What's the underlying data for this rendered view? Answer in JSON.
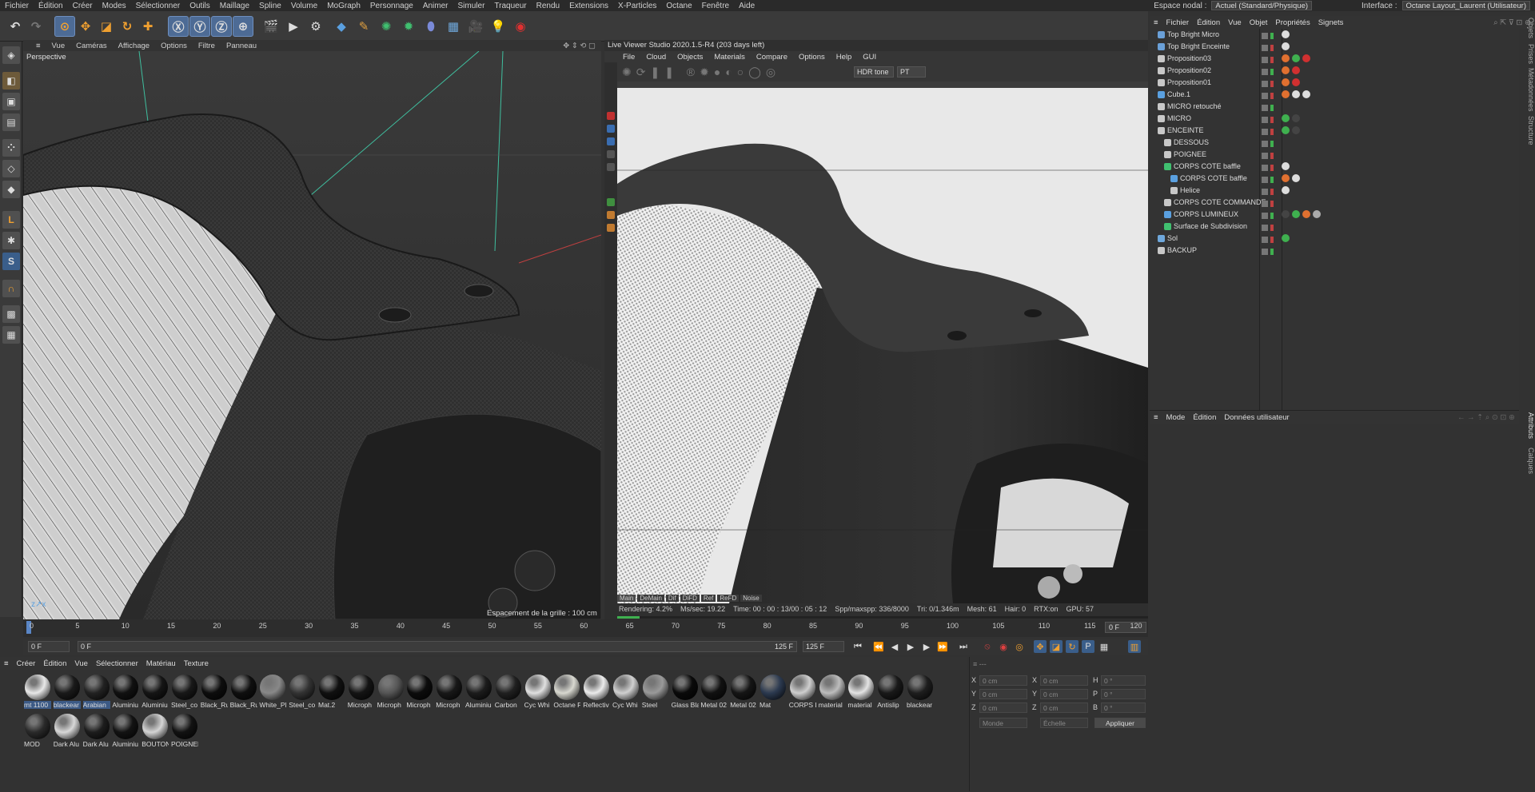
{
  "menubar": {
    "items": [
      "Fichier",
      "Édition",
      "Créer",
      "Modes",
      "Sélectionner",
      "Outils",
      "Maillage",
      "Spline",
      "Volume",
      "MoGraph",
      "Personnage",
      "Animer",
      "Simuler",
      "Traqueur",
      "Rendu",
      "Extensions",
      "X-Particles",
      "Octane",
      "Fenêtre",
      "Aide"
    ],
    "nodal_label": "Espace nodal :",
    "nodal_value": "Actuel (Standard/Physique)",
    "interface_label": "Interface :",
    "interface_value": "Octane Layout_Laurent (Utilisateur)"
  },
  "viewport": {
    "menu": [
      "Vue",
      "Caméras",
      "Affichage",
      "Options",
      "Filtre",
      "Panneau"
    ],
    "label": "Perspective",
    "grid_text": "Espacement de la grille : 100 cm"
  },
  "live_viewer": {
    "title": "Live Viewer Studio 2020.1.5-R4 (203 days left)",
    "menu": [
      "File",
      "Cloud",
      "Objects",
      "Materials",
      "Compare",
      "Options",
      "Help",
      "GUI"
    ],
    "tone": "HDR tone",
    "mode": "PT",
    "tabs": [
      "Main",
      "DeMain",
      "Dif",
      "DiFD",
      "Ref",
      "ReFD",
      "Noise"
    ],
    "status": {
      "rendering": "Rendering: 4.2%",
      "ms": "Ms/sec: 19.22",
      "time": "Time: 00 : 00 : 13/00 : 05 : 12",
      "spp": "Spp/maxspp: 336/8000",
      "tri": "Tri: 0/1.346m",
      "mesh": "Mesh: 61",
      "hair": "Hair: 0",
      "rtx": "RTX:on",
      "gpu": "GPU: 57"
    },
    "progress": 0.042
  },
  "object_manager": {
    "menu": [
      "Fichier",
      "Édition",
      "Vue",
      "Objet",
      "Propriétés",
      "Signets"
    ],
    "objects": [
      {
        "name": "Top Bright Micro",
        "depth": 0
      },
      {
        "name": "Top Bright Enceinte",
        "depth": 0
      },
      {
        "name": "Proposition03",
        "depth": 0
      },
      {
        "name": "Proposition02",
        "depth": 0
      },
      {
        "name": "Proposition01",
        "depth": 0
      },
      {
        "name": "Cube.1",
        "depth": 0
      },
      {
        "name": "MICRO retouché",
        "depth": 0
      },
      {
        "name": "MICRO",
        "depth": 0
      },
      {
        "name": "ENCEINTE",
        "depth": 0
      },
      {
        "name": "DESSOUS",
        "depth": 1
      },
      {
        "name": "POIGNEE",
        "depth": 1
      },
      {
        "name": "CORPS COTE  baffle",
        "depth": 1
      },
      {
        "name": "CORPS COTE  baffle",
        "depth": 2
      },
      {
        "name": "Helice",
        "depth": 2
      },
      {
        "name": "CORPS COTE COMMANDE",
        "depth": 1
      },
      {
        "name": "CORPS LUMINEUX",
        "depth": 1
      },
      {
        "name": "Surface de Subdivision",
        "depth": 1
      },
      {
        "name": "Sol",
        "depth": 0
      },
      {
        "name": "BACKUP",
        "depth": 0
      }
    ],
    "side_tabs": [
      "Objets",
      "Prises",
      "Métadonnées",
      "Structure"
    ]
  },
  "attributes": {
    "menu": [
      "Mode",
      "Édition",
      "Données utilisateur"
    ],
    "side_tabs": [
      "Attributs",
      "Calques"
    ]
  },
  "timeline": {
    "ticks": [
      "0",
      "5",
      "10",
      "15",
      "20",
      "25",
      "30",
      "35",
      "40",
      "45",
      "50",
      "55",
      "60",
      "65",
      "70",
      "75",
      "80",
      "85",
      "90",
      "95",
      "100",
      "105",
      "110",
      "115",
      "120"
    ],
    "current_box": "0 F",
    "start": "0 F",
    "start2": "0 F",
    "end": "125 F",
    "end2": "125 F"
  },
  "materials": {
    "menu": [
      "Créer",
      "Édition",
      "Vue",
      "Sélectionner",
      "Matériau",
      "Texture"
    ],
    "items": [
      {
        "label": "mt 1100",
        "color": "#e8e8e8"
      },
      {
        "label": "blackear",
        "color": "#1a1a1a"
      },
      {
        "label": "Arabian",
        "color": "#222"
      },
      {
        "label": "Aluminiu",
        "color": "#111"
      },
      {
        "label": "Aluminiu",
        "color": "#151515"
      },
      {
        "label": "Steel_co",
        "color": "#181818"
      },
      {
        "label": "Black_Ru",
        "color": "#0d0d0d"
      },
      {
        "label": "Black_Ru",
        "color": "#0f0f0f"
      },
      {
        "label": "White_Pl",
        "color": "#888"
      },
      {
        "label": "Steel_co",
        "color": "#333"
      },
      {
        "label": "Mat.2",
        "color": "#101010"
      },
      {
        "label": "Microph",
        "color": "#141414"
      },
      {
        "label": "Microph",
        "color": "#555"
      },
      {
        "label": "Microph",
        "color": "#0c0c0c"
      },
      {
        "label": "Microph",
        "color": "#181818"
      },
      {
        "label": "Aluminiu",
        "color": "#1c1c1c"
      },
      {
        "label": "Carbon",
        "color": "#202020"
      },
      {
        "label": "Cyc Whi",
        "color": "#e0e0e0"
      },
      {
        "label": "Octane F",
        "color": "#d8d8d0"
      },
      {
        "label": "Reflectiv",
        "color": "#ececec"
      },
      {
        "label": "Cyc Whi",
        "color": "#d0d0d0"
      },
      {
        "label": "Steel",
        "color": "#9a9a9a"
      },
      {
        "label": "Glass Bla",
        "color": "#0a0a0a"
      },
      {
        "label": "Metal 02",
        "color": "#111"
      },
      {
        "label": "Metal 02",
        "color": "#151515"
      },
      {
        "label": "Mat",
        "color": "#2c3a50"
      },
      {
        "label": "CORPS L",
        "color": "#cfcfcf"
      },
      {
        "label": "material",
        "color": "#bdbdbd"
      },
      {
        "label": "material",
        "color": "#e4e4e4"
      },
      {
        "label": "Antislip",
        "color": "#191919"
      },
      {
        "label": "blackear",
        "color": "#1e1e1e"
      },
      {
        "label": "MOD",
        "color": "#2a2a2a"
      },
      {
        "label": "Dark Alu",
        "color": "#d8d8d8"
      },
      {
        "label": "Dark Alu",
        "color": "#1d1d1d"
      },
      {
        "label": "Aluminiu",
        "color": "#131313"
      },
      {
        "label": "BOUTON",
        "color": "#d4d4d4"
      },
      {
        "label": "POIGNEE",
        "color": "#121212"
      }
    ]
  },
  "coords": {
    "rows": [
      {
        "a": "X",
        "av": "0 cm",
        "b": "X",
        "bv": "0 cm",
        "c": "H",
        "cv": "0 °"
      },
      {
        "a": "Y",
        "av": "0 cm",
        "b": "Y",
        "bv": "0 cm",
        "c": "P",
        "cv": "0 °"
      },
      {
        "a": "Z",
        "av": "0 cm",
        "b": "Z",
        "bv": "0 cm",
        "c": "B",
        "cv": "0 °"
      }
    ],
    "world": "Monde",
    "scale": "Échelle",
    "apply": "Appliquer"
  },
  "colors": {
    "accent": "#4d6b95",
    "selection": "#3c5a86",
    "grid_line": "#3fbf9f",
    "axis_red": "#c04040",
    "progress_green": "#3fb04f"
  }
}
